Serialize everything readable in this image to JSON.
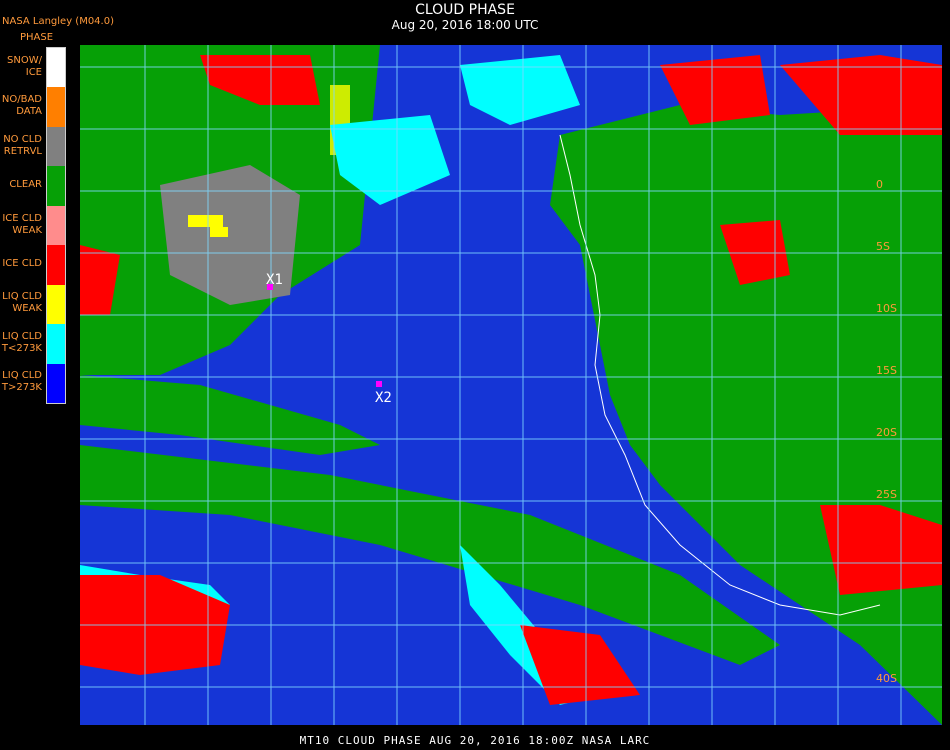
{
  "header": {
    "agency": "NASA Langley (M04.0)",
    "title": "CLOUD PHASE",
    "subtitle": "Aug 20, 2016 18:00 UTC"
  },
  "legend": {
    "title": "PHASE",
    "items": [
      {
        "label": "SNOW/\nICE",
        "color": "#ffffff"
      },
      {
        "label": "NO/BAD\nDATA",
        "color": "#ff7f00"
      },
      {
        "label": "NO CLD\nRETRVL",
        "color": "#808080"
      },
      {
        "label": "CLEAR",
        "color": "#06a006"
      },
      {
        "label": "ICE CLD\nWEAK",
        "color": "#ff8c8c"
      },
      {
        "label": "ICE CLD",
        "color": "#ff0000"
      },
      {
        "label": "LIQ CLD\nWEAK",
        "color": "#ffff00"
      },
      {
        "label": "LIQ CLD\nT<273K",
        "color": "#00ffff"
      },
      {
        "label": "LIQ CLD\nT>273K",
        "color": "#0000ff"
      }
    ]
  },
  "map": {
    "markers": [
      {
        "label": "X1"
      },
      {
        "label": "X2"
      }
    ],
    "lat_labels": [
      "0",
      "5S",
      "10S",
      "15S",
      "20S",
      "25S",
      "40S"
    ]
  },
  "footer": {
    "text": "MT10  CLOUD PHASE   AUG 20, 2016 18:00Z   NASA LARC"
  }
}
